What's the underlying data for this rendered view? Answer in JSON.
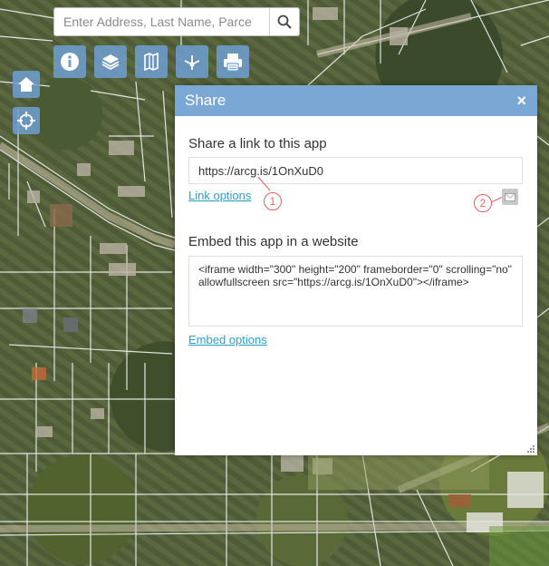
{
  "search": {
    "placeholder": "Enter Address, Last Name, Parce"
  },
  "toolbar": {
    "buttons": [
      "info-icon",
      "layers-icon",
      "legend-icon",
      "share-icon",
      "print-icon"
    ]
  },
  "side_tools": [
    "home-icon",
    "locate-icon"
  ],
  "share_panel": {
    "title": "Share",
    "close_label": "×",
    "link_section_label": "Share a link to this app",
    "link_url": "https://arcg.is/1OnXuD0",
    "link_options_label": "Link options",
    "embed_section_label": "Embed this app in a website",
    "embed_code": "<iframe width=\"300\" height=\"200\" frameborder=\"0\" scrolling=\"no\" allowfullscreen src=\"https://arcg.is/1OnXuD0\"></iframe>",
    "embed_options_label": "Embed options",
    "callout_1": "1",
    "callout_2": "2"
  },
  "colors": {
    "panel_header": "#7aa7d4",
    "link": "#2a9fc9",
    "callout": "#e06060",
    "tool_button": "#6ea0d2"
  }
}
